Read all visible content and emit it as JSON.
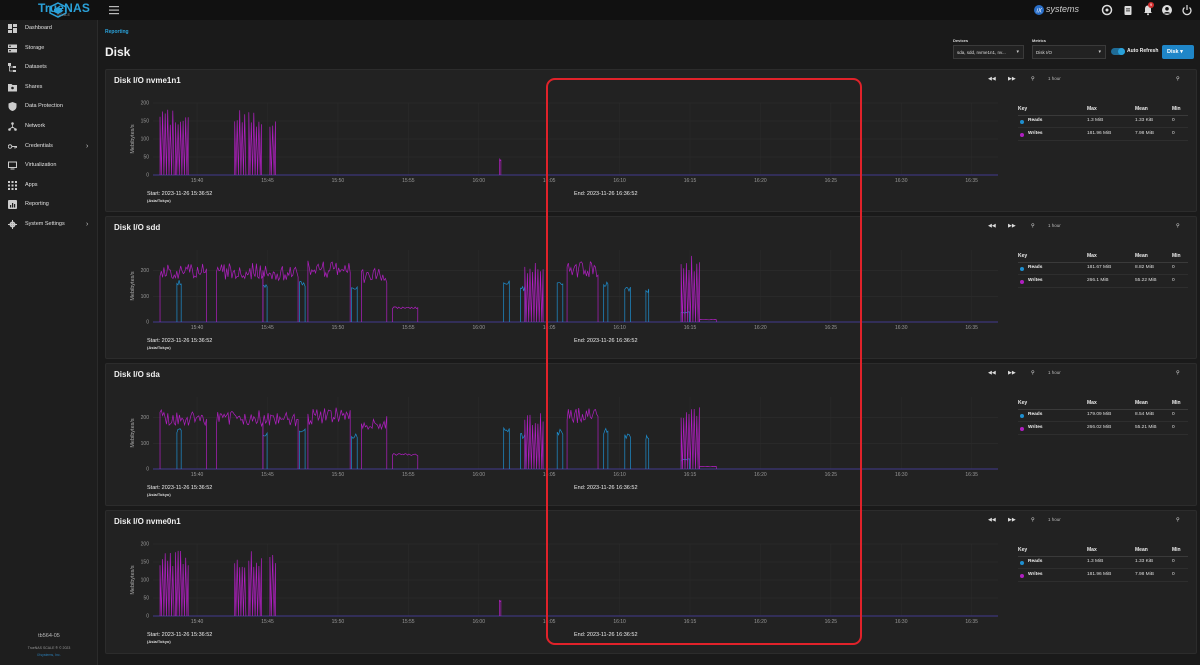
{
  "app": {
    "logo_text": "TrueNAS",
    "logo_sub": "SCALE",
    "vendor": "systems",
    "notification_count": "9"
  },
  "sidebar": {
    "items": [
      {
        "label": "Dashboard",
        "icon": "dashboard-icon"
      },
      {
        "label": "Storage",
        "icon": "storage-icon"
      },
      {
        "label": "Datasets",
        "icon": "datasets-icon"
      },
      {
        "label": "Shares",
        "icon": "shares-icon"
      },
      {
        "label": "Data Protection",
        "icon": "shield-icon"
      },
      {
        "label": "Network",
        "icon": "network-icon"
      },
      {
        "label": "Credentials",
        "icon": "key-icon",
        "expandable": true
      },
      {
        "label": "Virtualization",
        "icon": "monitor-icon"
      },
      {
        "label": "Apps",
        "icon": "apps-grid-icon"
      },
      {
        "label": "Reporting",
        "icon": "reporting-icon"
      },
      {
        "label": "System Settings",
        "icon": "gear-icon",
        "expandable": true
      }
    ],
    "hostname": "tb564-05",
    "version": "TrueNAS SCALE ® © 2023",
    "copyright": "iXsystems, Inc."
  },
  "header": {
    "breadcrumb": "Reporting",
    "title": "Disk",
    "devices_label": "Devices",
    "devices_value": "sda, sdd, nvme1n1, nv...",
    "metrics_label": "Metrics",
    "metrics_value": "Disk I/O",
    "auto_refresh_label": "Auto Refresh",
    "auto_refresh_on": true,
    "disk_button": "Disk"
  },
  "colors": {
    "accent": "#2aa1d9",
    "reads": "#1e8fd0",
    "writes": "#b01fc1",
    "highlight": "#e0222a"
  },
  "charts": [
    {
      "title": "Disk I/O nvme1n1",
      "start": "Start:  2023-11-26 15:36:52",
      "end": "End:  2023-11-26 16:36:52",
      "tz": "(Asia/Tokyo)",
      "range": "1 hour",
      "legend": {
        "key": "Key",
        "max": "Max",
        "mean": "Mean",
        "min": "Min",
        "rows": [
          {
            "name": "Reads",
            "max": "1.3 MiB",
            "mean": "1.33 KiB",
            "min": "0"
          },
          {
            "name": "Writes",
            "max": "181.96 MiB",
            "mean": "7.98 MiB",
            "min": "0"
          }
        ]
      }
    },
    {
      "title": "Disk I/O sdd",
      "start": "Start:  2023-11-26 15:36:52",
      "end": "End:  2023-11-26 16:36:52",
      "tz": "(Asia/Tokyo)",
      "range": "1 hour",
      "legend": {
        "key": "Key",
        "max": "Max",
        "mean": "Mean",
        "min": "Min",
        "rows": [
          {
            "name": "Reads",
            "max": "181.67 MiB",
            "mean": "8.82 MiB",
            "min": "0"
          },
          {
            "name": "Writes",
            "max": "266.1 MiB",
            "mean": "55.22 MiB",
            "min": "0"
          }
        ]
      }
    },
    {
      "title": "Disk I/O sda",
      "start": "Start:  2023-11-26 15:36:52",
      "end": "End:  2023-11-26 16:36:52",
      "tz": "(Asia/Tokyo)",
      "range": "1 hour",
      "legend": {
        "key": "Key",
        "max": "Max",
        "mean": "Mean",
        "min": "Min",
        "rows": [
          {
            "name": "Reads",
            "max": "179.09 MiB",
            "mean": "8.54 MiB",
            "min": "0"
          },
          {
            "name": "Writes",
            "max": "266.02 MiB",
            "mean": "55.21 MiB",
            "min": "0"
          }
        ]
      }
    },
    {
      "title": "Disk I/O nvme0n1",
      "start": "Start:  2023-11-26 15:36:52",
      "end": "End:  2023-11-26 16:36:52",
      "tz": "(Asia/Tokyo)",
      "range": "1 hour",
      "legend": {
        "key": "Key",
        "max": "Max",
        "mean": "Mean",
        "min": "Min",
        "rows": [
          {
            "name": "Reads",
            "max": "1.3 MiB",
            "mean": "1.33 KiB",
            "min": "0"
          },
          {
            "name": "Writes",
            "max": "181.96 MiB",
            "mean": "7.98 MiB",
            "min": "0"
          }
        ]
      }
    }
  ],
  "chart_data": [
    {
      "type": "line",
      "title": "Disk I/O nvme1n1",
      "ylabel": "Mebibytes/s",
      "x_ticks": [
        "15:40",
        "15:45",
        "15:50",
        "15:55",
        "16:00",
        "16:05",
        "16:10",
        "16:15",
        "16:20",
        "16:25",
        "16:30",
        "16:35"
      ],
      "y_ticks": [
        0,
        50,
        100,
        150,
        200
      ],
      "ylim": [
        0,
        200
      ],
      "series": [
        {
          "name": "Reads",
          "points": [
            [
              0,
              0
            ],
            [
              60,
              0
            ]
          ]
        },
        {
          "name": "Writes",
          "bursts": [
            [
              0.5,
              1.5,
              185
            ],
            [
              1.6,
              2.5,
              185
            ],
            [
              5.8,
              6.6,
              185
            ],
            [
              6.8,
              7.7,
              185
            ],
            [
              8.3,
              8.7,
              180
            ],
            [
              24.6,
              24.7,
              45
            ]
          ]
        }
      ]
    },
    {
      "type": "line",
      "title": "Disk I/O sdd",
      "ylabel": "Mebibytes/s",
      "x_ticks": [
        "15:40",
        "15:45",
        "15:50",
        "15:55",
        "16:00",
        "16:05",
        "16:10",
        "16:15",
        "16:20",
        "16:25",
        "16:30",
        "16:35"
      ],
      "y_ticks": [
        0,
        100,
        200
      ],
      "ylim": [
        0,
        280
      ],
      "series": [
        {
          "name": "Reads",
          "bursts": [
            [
              1.7,
              2.0,
              165
            ],
            [
              7.8,
              8.1,
              150
            ],
            [
              10.4,
              10.8,
              160
            ],
            [
              14.1,
              14.5,
              140
            ],
            [
              24.9,
              25.3,
              170
            ],
            [
              26.1,
              26.4,
              140
            ],
            [
              28.7,
              29.1,
              155
            ],
            [
              32.0,
              32.3,
              160
            ],
            [
              33.5,
              33.9,
              140
            ],
            [
              35.0,
              35.2,
              135
            ],
            [
              37.5,
              38.1,
              40
            ]
          ]
        },
        {
          "name": "Writes",
          "bursts": [
            [
              0.5,
              3.8,
              230
            ],
            [
              4.5,
              7.8,
              230
            ],
            [
              7.8,
              10.3,
              220
            ],
            [
              11.0,
              14.0,
              240
            ],
            [
              14.8,
              16.6,
              210
            ],
            [
              17.0,
              18.8,
              60
            ],
            [
              26.4,
              27.7,
              230
            ],
            [
              29.4,
              31.6,
              240
            ],
            [
              37.5,
              38.8,
              260
            ],
            [
              38.8,
              40.0,
              10
            ]
          ]
        }
      ]
    },
    {
      "type": "line",
      "title": "Disk I/O sda",
      "ylabel": "Mebibytes/s",
      "x_ticks": [
        "15:40",
        "15:45",
        "15:50",
        "15:55",
        "16:00",
        "16:05",
        "16:10",
        "16:15",
        "16:20",
        "16:25",
        "16:30",
        "16:35"
      ],
      "y_ticks": [
        0,
        100,
        200
      ],
      "ylim": [
        0,
        280
      ],
      "series": [
        {
          "name": "Reads",
          "bursts": [
            [
              1.7,
              2.0,
              165
            ],
            [
              7.8,
              8.1,
              150
            ],
            [
              10.4,
              10.8,
              160
            ],
            [
              14.1,
              14.5,
              140
            ],
            [
              24.9,
              25.3,
              170
            ],
            [
              26.1,
              26.4,
              140
            ],
            [
              28.7,
              29.1,
              155
            ],
            [
              32.0,
              32.3,
              160
            ],
            [
              33.5,
              33.9,
              140
            ],
            [
              35.0,
              35.2,
              135
            ],
            [
              37.5,
              38.1,
              40
            ]
          ]
        },
        {
          "name": "Writes",
          "bursts": [
            [
              0.5,
              3.8,
              230
            ],
            [
              4.5,
              7.8,
              230
            ],
            [
              7.8,
              10.3,
              220
            ],
            [
              11.0,
              14.0,
              240
            ],
            [
              14.8,
              16.6,
              210
            ],
            [
              17.0,
              18.8,
              60
            ],
            [
              26.4,
              27.7,
              230
            ],
            [
              29.4,
              31.6,
              240
            ],
            [
              37.5,
              38.8,
              260
            ],
            [
              38.8,
              40.0,
              10
            ]
          ]
        }
      ]
    },
    {
      "type": "line",
      "title": "Disk I/O nvme0n1",
      "ylabel": "Mebibytes/s",
      "x_ticks": [
        "15:40",
        "15:45",
        "15:50",
        "15:55",
        "16:00",
        "16:05",
        "16:10",
        "16:15",
        "16:20",
        "16:25",
        "16:30",
        "16:35"
      ],
      "y_ticks": [
        0,
        50,
        100,
        150,
        200
      ],
      "ylim": [
        0,
        200
      ],
      "series": [
        {
          "name": "Reads",
          "points": [
            [
              0,
              0
            ],
            [
              60,
              0
            ]
          ]
        },
        {
          "name": "Writes",
          "bursts": [
            [
              0.5,
              1.5,
              185
            ],
            [
              1.6,
              2.5,
              185
            ],
            [
              5.8,
              6.6,
              185
            ],
            [
              6.8,
              7.7,
              185
            ],
            [
              8.3,
              8.7,
              180
            ],
            [
              24.6,
              24.7,
              45
            ]
          ]
        }
      ]
    }
  ]
}
